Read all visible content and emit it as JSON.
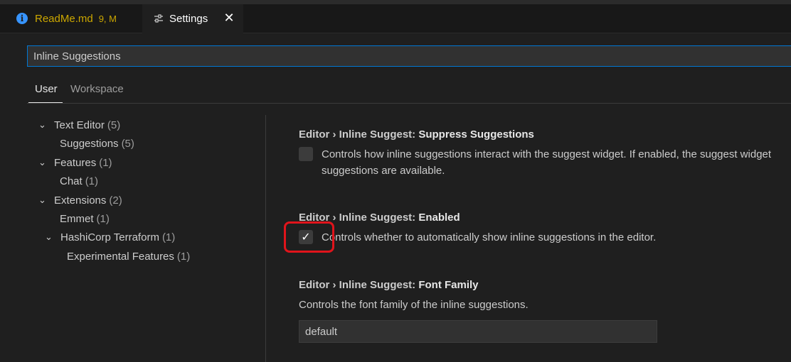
{
  "tabs": {
    "readme": {
      "label": "ReadMe.md",
      "badge": "9, M",
      "icon": "info-icon"
    },
    "settings": {
      "label": "Settings",
      "icon": "settings-icon",
      "close": "✕"
    }
  },
  "search": {
    "value": "Inline Suggestions"
  },
  "scope_tabs": {
    "user": "User",
    "workspace": "Workspace"
  },
  "toc": [
    {
      "label": "Text Editor",
      "count": "(5)",
      "expanded": true,
      "indent": 0
    },
    {
      "label": "Suggestions",
      "count": "(5)",
      "indent": 1
    },
    {
      "label": "Features",
      "count": "(1)",
      "expanded": true,
      "indent": 0
    },
    {
      "label": "Chat",
      "count": "(1)",
      "indent": 1
    },
    {
      "label": "Extensions",
      "count": "(2)",
      "expanded": true,
      "indent": 0
    },
    {
      "label": "Emmet",
      "count": "(1)",
      "indent": 1
    },
    {
      "label": "HashiCorp Terraform",
      "count": "(1)",
      "expanded": true,
      "indent": 1
    },
    {
      "label": "Experimental Features",
      "count": "(1)",
      "indent": 2
    }
  ],
  "settings": {
    "suppress": {
      "category": "Editor › Inline Suggest: ",
      "name": "Suppress Suggestions",
      "desc_line1": "Controls how inline suggestions interact with the suggest widget. If enabled, the suggest widget",
      "desc_line2": "suggestions are available.",
      "checked": false
    },
    "enabled": {
      "category": "Editor › Inline Suggest: ",
      "name": "Enabled",
      "desc": "Controls whether to automatically show inline suggestions in the editor.",
      "checked": true,
      "check_glyph": "✓"
    },
    "font_family": {
      "category": "Editor › Inline Suggest: ",
      "name": "Font Family",
      "desc": "Controls the font family of the inline suggestions.",
      "value": "default"
    }
  },
  "colors": {
    "accent": "#0078d4",
    "highlight": "#e0141b",
    "warning": "#cca700"
  }
}
